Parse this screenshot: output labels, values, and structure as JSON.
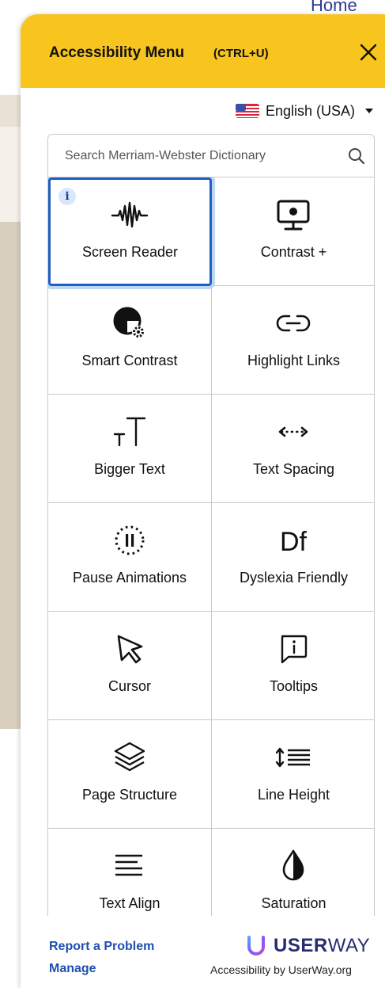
{
  "background": {
    "home_link": "Home"
  },
  "panel": {
    "title": "Accessibility Menu",
    "shortcut": "(CTRL+U)",
    "close_icon": "close-icon",
    "language": {
      "flag": "us-flag-icon",
      "label": "English (USA)"
    },
    "search": {
      "placeholder": "Search Merriam-Webster Dictionary",
      "value": ""
    },
    "tiles": [
      {
        "label": "Screen Reader",
        "icon": "sound-wave-icon",
        "selected": true,
        "badge": "i"
      },
      {
        "label": "Contrast +",
        "icon": "monitor-icon"
      },
      {
        "label": "Smart Contrast",
        "icon": "half-circle-gear-icon"
      },
      {
        "label": "Highlight Links",
        "icon": "link-icon"
      },
      {
        "label": "Bigger Text",
        "icon": "text-size-icon"
      },
      {
        "label": "Text Spacing",
        "icon": "spacing-arrows-icon"
      },
      {
        "label": "Pause Animations",
        "icon": "pause-circle-icon"
      },
      {
        "label": "Dyslexia Friendly",
        "icon": "df-glyph",
        "glyph": "Df"
      },
      {
        "label": "Cursor",
        "icon": "cursor-arrow-icon"
      },
      {
        "label": "Tooltips",
        "icon": "speech-bubble-info-icon"
      },
      {
        "label": "Page Structure",
        "icon": "layers-icon"
      },
      {
        "label": "Line Height",
        "icon": "line-height-icon"
      },
      {
        "label": "Text Align",
        "icon": "align-left-icon"
      },
      {
        "label": "Saturation",
        "icon": "drop-icon"
      }
    ],
    "footer": {
      "report": "Report a Problem",
      "manage": "Manage",
      "brand_bold": "USER",
      "brand_light": "WAY",
      "tagline": "Accessibility by UserWay.org"
    }
  },
  "colors": {
    "header": "#f7c51e",
    "link": "#1f4fb0",
    "selected_border": "#1f5fbf",
    "brand": "#2a2a72"
  }
}
